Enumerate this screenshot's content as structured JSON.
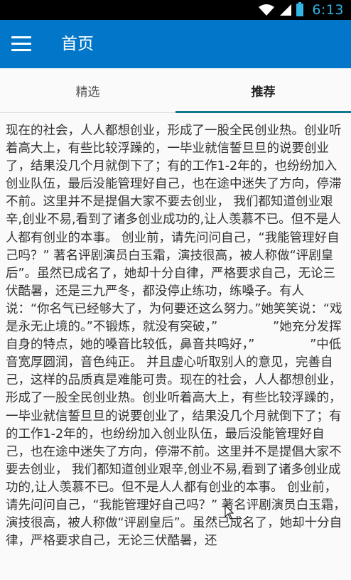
{
  "status_bar": {
    "time": "6:13",
    "icons": [
      "wifi-icon",
      "signal-icon",
      "battery-icon"
    ]
  },
  "app_bar": {
    "title": "首页",
    "menu_icon": "hamburger-menu-icon",
    "color": "#0277c9"
  },
  "tabs": [
    {
      "label": "精选",
      "active": false
    },
    {
      "label": "推荐",
      "active": true
    }
  ],
  "colors": {
    "status_accent": "#33b5e5",
    "tab_indicator": "#0e7a8c",
    "background": "#fafafa"
  },
  "article": {
    "text": "现在的社会，人人都想创业，形成了一股全民创业热。创业听着高大上，有些比较浮躁的，一毕业就信誓旦旦的说要创业了，结果没几个月就倒下了；有的工作1-2年的，也纷纷加入创业队伍，最后没能管理好自己，也在途中迷失了方向，停滞不前。这里并不是提倡大家不要去创业， 我们都知道创业艰辛,创业不易,看到了诸多创业成功的,让人羡慕不已。但不是人人都有创业的本事。 创业前，请先问问自己，“我能管理好自己吗？” 著名评剧演员白玉霜，演技很高，被人称做“评剧皇后”。虽然已成名了，她却十分自律，严格要求自己，无论三伏酷暑，还是三九严冬，都没停止练功，练嗓子。有人说：“你名气已经够大了，为何要还这么努力。”她笑笑说：“戏是永无止境的。”不锻炼，就没有突破，”              ”她充分发挥自身的特点，她的嗓音比较低，鼻音共鸣好，”              ”中低音宽厚圆润，音色纯正。 并且虚心听取别人的意见，完善自己，这样的品质真是难能可贵。现在的社会，人人都想创业，形成了一股全民创业热。创业听着高大上，有些比较浮躁的，一毕业就信誓旦旦的说要创业了，结果没几个月就倒下了；有的工作1-2年的，也纷纷加入创业队伍，最后没能管理好自己，也在途中迷失了方向，停滞不前。这里并不是提倡大家不要去创业， 我们都知道创业艰辛,创业不易,看到了诸多创业成功的,让人羡慕不已。但不是人人都有创业的本事。 创业前，请先问问自己，“我能管理好自己吗？” 著名评剧演员白玉霜，演技很高，被人称做“评剧皇后”。虽然已成名了，她却十分自律，严格要求自己，无论三伏酷暑，还"
  }
}
